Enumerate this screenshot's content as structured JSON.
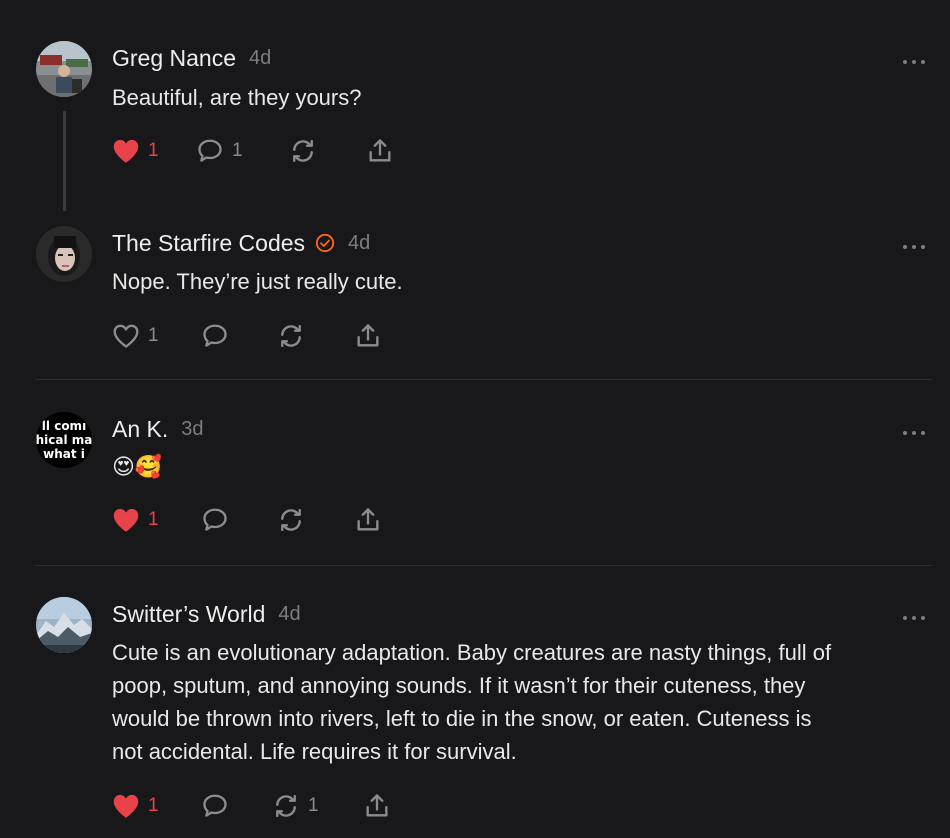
{
  "comments": [
    {
      "author": "Greg Nance",
      "time": "4d",
      "text": "Beautiful, are they yours?",
      "liked": true,
      "likes": "1",
      "replies": "1",
      "restacks": "",
      "avatar": "photo"
    },
    {
      "author": "The Starfire Codes",
      "time": "4d",
      "verified": true,
      "text": "Nope. They’re just really cute.",
      "liked": false,
      "likes": "1",
      "replies": "",
      "restacks": "",
      "avatar": "photo"
    },
    {
      "author": "An K.",
      "time": "3d",
      "text": "😍🥰",
      "liked": true,
      "likes": "1",
      "replies": "",
      "restacks": "",
      "avatar": "text-image",
      "avatar_text": [
        "ll comı",
        "hical ma",
        "what i"
      ]
    },
    {
      "author": "Switter’s World",
      "time": "4d",
      "text_lines": [
        "Cute is an evolutionary adaptation. Baby creatures are nasty things, full of",
        "poop, sputum, and annoying sounds. If it wasn’t for their cuteness, they",
        "would be thrown into rivers, left to die in the snow, or eaten. Cuteness is",
        "not accidental. Life requires it for survival."
      ],
      "liked": true,
      "likes": "1",
      "replies": "",
      "restacks": "1",
      "avatar": "photo"
    }
  ],
  "icons": {
    "like": "heart-icon",
    "reply": "speech-bubble-icon",
    "restack": "restack-icon",
    "share": "share-icon",
    "more": "more-options-icon",
    "verified": "verified-check-icon"
  },
  "colors": {
    "background": "#18181a",
    "liked": "#e8424a",
    "verified": "#ff6719",
    "muted": "#8c8c90"
  }
}
